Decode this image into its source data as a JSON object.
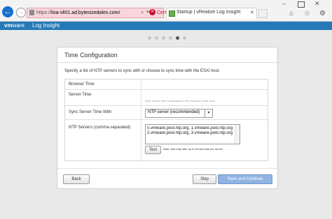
{
  "browser": {
    "url_prefix": "https://",
    "url_host": "lisa-vli01.ad.bytesizedalex.com/",
    "certificate_error": "Certificate error",
    "tab_title": "Startup | vRealize Log Insight"
  },
  "app": {
    "brand_vm": "vm",
    "brand_ware": "ware",
    "product_name": "Log Insight"
  },
  "wizard": {
    "step_count": 6,
    "current_step": 5
  },
  "card": {
    "title": "Time Configuration",
    "description": "Specify a list of NTP servers to sync with or choose to sync time with the ESXi host.",
    "rows": {
      "browser_time_label": "Browser Time",
      "server_time_label": "Server Time",
      "server_time_note": "Note: server time is displayed in the browser's time zone",
      "sync_label": "Sync Server Time With",
      "sync_value": "NTP server (recommended)",
      "ntp_label": "NTP Servers (comma-separated)",
      "ntp_value": "0.vmware.pool.ntp.org, 1.vmware.pool.ntp.org,\n2.vmware.pool.ntp.org, 3.vmware.pool.ntp.org",
      "test_label": "Test",
      "test_note": "Note: test may take up to 20 seconds per server"
    },
    "buttons": {
      "back": "Back",
      "skip": "Skip",
      "save": "Save and Continue"
    }
  },
  "colors": {
    "header_blue": "#2679b9",
    "primary_button": "#8fb4e3",
    "address_bar_error": "#f8d6dc",
    "cert_error_red": "#c8102e"
  }
}
